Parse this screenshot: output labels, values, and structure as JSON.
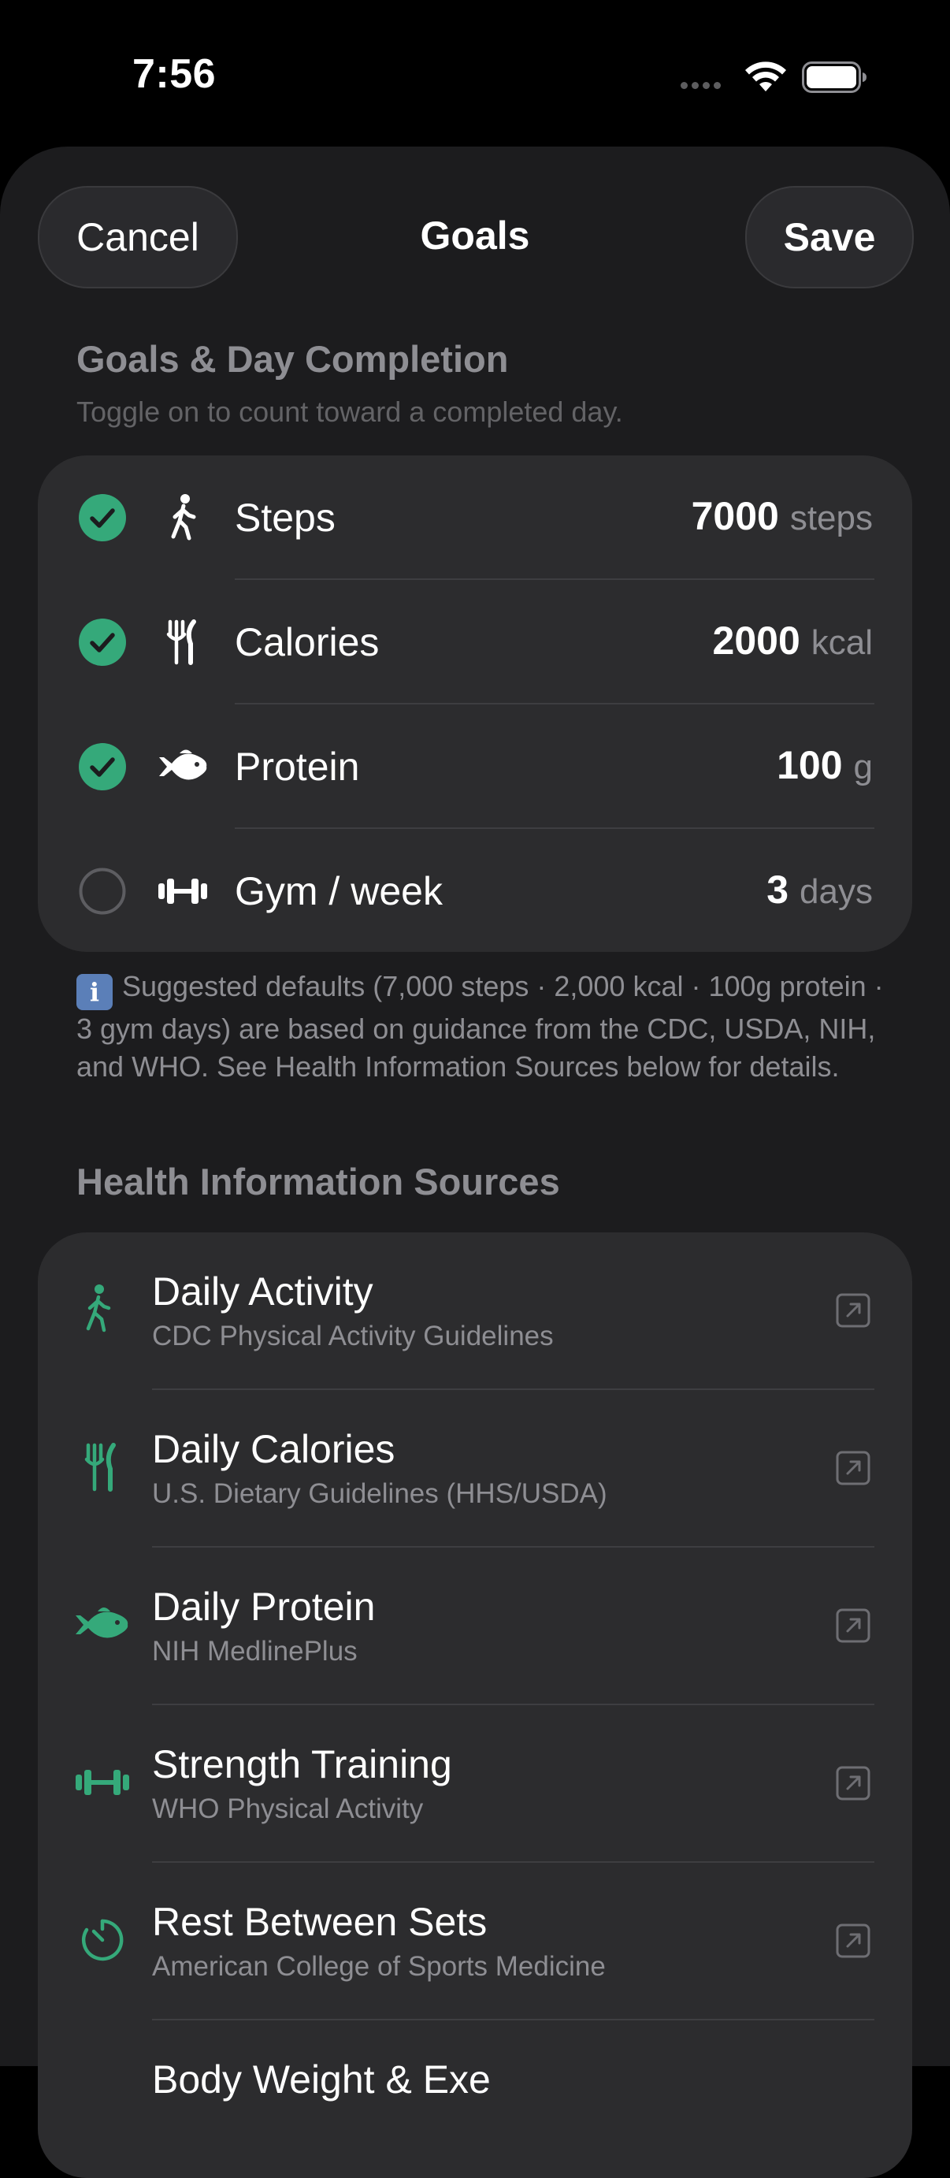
{
  "status_bar": {
    "time": "7:56"
  },
  "nav": {
    "cancel_label": "Cancel",
    "title": "Goals",
    "save_label": "Save"
  },
  "goals_section": {
    "title": "Goals & Day Completion",
    "subtitle": "Toggle on to count toward a completed day.",
    "goals": [
      {
        "label": "Steps",
        "value": "7000",
        "unit": "steps",
        "enabled": true,
        "icon": "walking-figure-icon"
      },
      {
        "label": "Calories",
        "value": "2000",
        "unit": "kcal",
        "enabled": true,
        "icon": "fork-knife-icon"
      },
      {
        "label": "Protein",
        "value": "100",
        "unit": "g",
        "enabled": true,
        "icon": "fish-icon"
      },
      {
        "label": "Gym / week",
        "value": "3",
        "unit": "days",
        "enabled": false,
        "icon": "dumbbell-icon"
      }
    ]
  },
  "note": {
    "badge": "i",
    "text": "Suggested defaults (7,000 steps · 2,000 kcal · 100g protein · 3 gym days) are based on guidance from the CDC, USDA, NIH, and WHO. See Health Information Sources below for details."
  },
  "sources_section": {
    "title": "Health Information Sources",
    "items": [
      {
        "title": "Daily Activity",
        "subtitle": "CDC Physical Activity Guidelines",
        "icon": "walking-figure-icon"
      },
      {
        "title": "Daily Calories",
        "subtitle": "U.S. Dietary Guidelines (HHS/USDA)",
        "icon": "fork-knife-icon"
      },
      {
        "title": "Daily Protein",
        "subtitle": "NIH MedlinePlus",
        "icon": "fish-icon"
      },
      {
        "title": "Strength Training",
        "subtitle": "WHO Physical Activity",
        "icon": "dumbbell-icon"
      },
      {
        "title": "Rest Between Sets",
        "subtitle": "American College of Sports Medicine",
        "icon": "timer-icon"
      },
      {
        "title": "Body Weight & Exe",
        "subtitle": "",
        "icon": ""
      }
    ]
  },
  "colors": {
    "accent": "#35a97a",
    "background": "#1c1c1e",
    "card": "#2c2c2e",
    "secondary_text": "#8e8e93"
  }
}
